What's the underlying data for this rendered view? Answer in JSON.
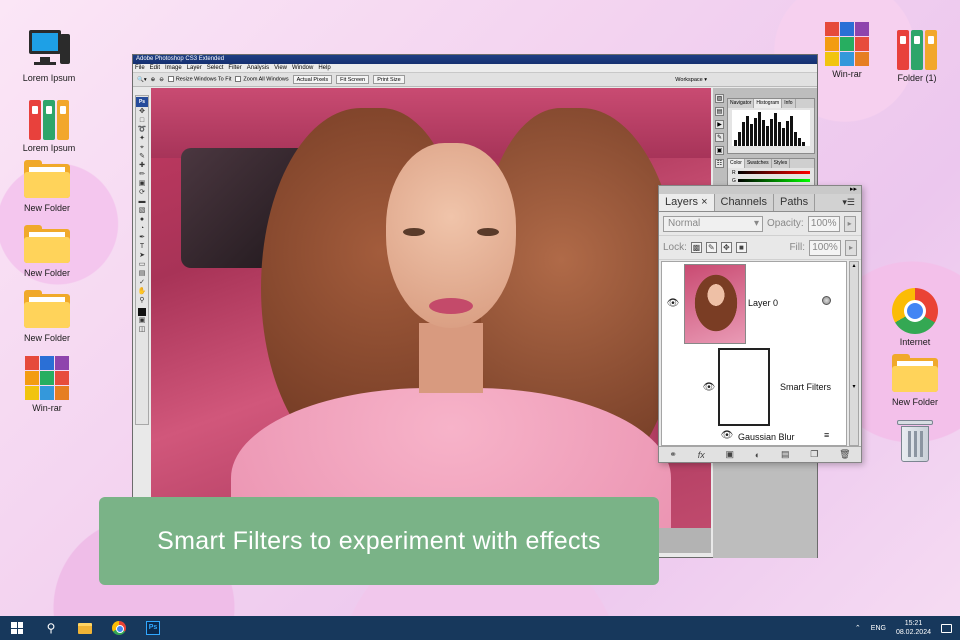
{
  "desktop": {
    "left_icons": [
      {
        "label": "Lorem Ipsum",
        "icon": "computer-icon"
      },
      {
        "label": "Lorem Ipsum",
        "icon": "binders-icon"
      },
      {
        "label": "New Folder",
        "icon": "folder-icon"
      },
      {
        "label": "New Folder",
        "icon": "folder-icon"
      },
      {
        "label": "New Folder",
        "icon": "folder-icon"
      },
      {
        "label": "Win-rar",
        "icon": "winrar-icon"
      }
    ],
    "right_icons": [
      {
        "label": "Win-rar",
        "icon": "winrar-icon"
      },
      {
        "label": "Folder (1)",
        "icon": "binders-icon"
      },
      {
        "label": "Internet",
        "icon": "chrome-icon"
      },
      {
        "label": "New Folder",
        "icon": "folder-icon"
      },
      {
        "label": "",
        "icon": "trash-icon"
      }
    ]
  },
  "photoshop": {
    "title": "Adobe Photoshop CS3 Extended",
    "menu": [
      "File",
      "Edit",
      "Image",
      "Layer",
      "Select",
      "Filter",
      "Analysis",
      "View",
      "Window",
      "Help"
    ],
    "options": {
      "resize_windows": "Resize Windows To Fit",
      "zoom_all": "Zoom All Windows",
      "actual_pixels": "Actual Pixels",
      "fit_screen": "Fit Screen",
      "print_size": "Print Size",
      "workspace": "Workspace ▾"
    },
    "toolbox_logo": "Ps",
    "mini_panels": {
      "nav_tabs": [
        "Navigator",
        "Histogram",
        "Info"
      ],
      "color_tabs": [
        "Color",
        "Swatches",
        "Styles"
      ],
      "color_channels": [
        "R",
        "G",
        "B"
      ]
    }
  },
  "layers_panel": {
    "tabs": [
      "Layers ×",
      "Channels",
      "Paths"
    ],
    "blend_mode": "Normal",
    "opacity_label": "Opacity:",
    "opacity_value": "100%",
    "lock_label": "Lock:",
    "fill_label": "Fill:",
    "fill_value": "100%",
    "layer_name": "Layer 0",
    "smart_filters": "Smart Filters",
    "filter_name": "Gaussian Blur"
  },
  "caption": "Smart Filters to experiment with effects",
  "taskbar": {
    "lang": "ENG",
    "time": "15:21",
    "date": "08.02.2024",
    "ps_label": "Ps"
  },
  "colors": {
    "caption_bg": "#7ab387",
    "taskbar_bg": "#17385c",
    "ps_title_bg": "#1f3f84"
  }
}
